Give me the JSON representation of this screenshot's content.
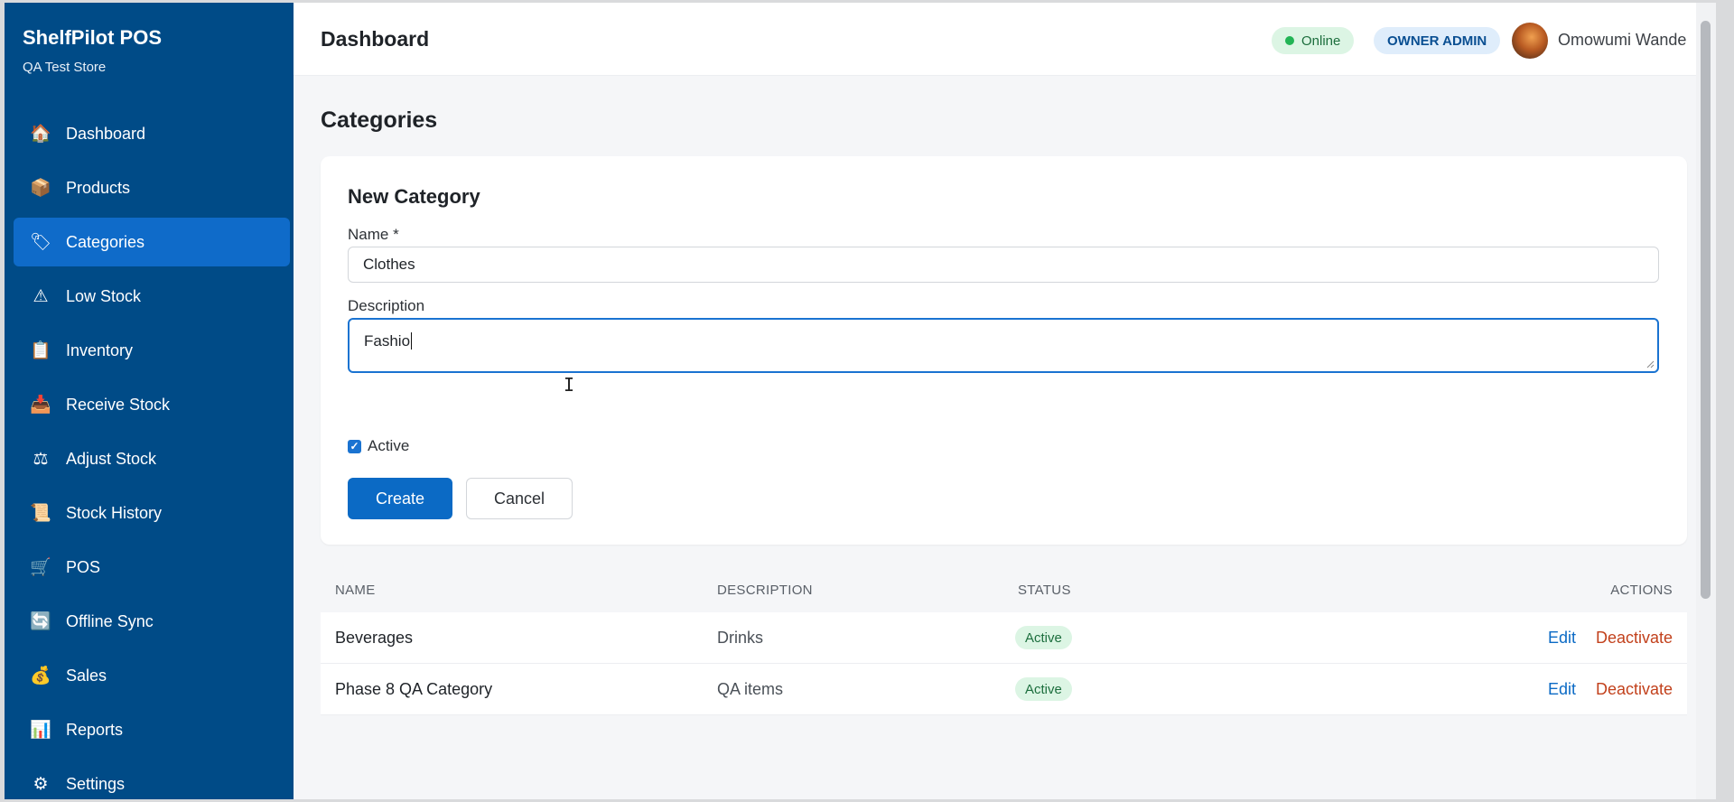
{
  "sidebar": {
    "brand": "ShelfPilot POS",
    "store": "QA Test Store",
    "items": [
      {
        "label": "Dashboard",
        "icon": "house-icon"
      },
      {
        "label": "Products",
        "icon": "box-icon"
      },
      {
        "label": "Categories",
        "icon": "tag-icon",
        "active": true
      },
      {
        "label": "Low Stock",
        "icon": "warning-icon"
      },
      {
        "label": "Inventory",
        "icon": "clipboard-icon"
      },
      {
        "label": "Receive Stock",
        "icon": "inbox-tray-icon"
      },
      {
        "label": "Adjust Stock",
        "icon": "scales-icon"
      },
      {
        "label": "Stock History",
        "icon": "scroll-icon"
      },
      {
        "label": "POS",
        "icon": "cart-icon"
      },
      {
        "label": "Offline Sync",
        "icon": "sync-icon"
      },
      {
        "label": "Sales",
        "icon": "money-bag-icon"
      },
      {
        "label": "Reports",
        "icon": "bar-chart-icon"
      },
      {
        "label": "Settings",
        "icon": "gear-icon"
      }
    ]
  },
  "header": {
    "title": "Dashboard",
    "status": "Online",
    "role": "OWNER ADMIN",
    "user": "Omowumi Wande"
  },
  "page": {
    "title": "Categories"
  },
  "form": {
    "title": "New Category",
    "name_label": "Name *",
    "name_value": "Clothes",
    "description_label": "Description",
    "description_value": "Fashio",
    "active_label": "Active",
    "active_checked": true,
    "create_label": "Create",
    "cancel_label": "Cancel"
  },
  "table": {
    "headers": {
      "name": "NAME",
      "description": "DESCRIPTION",
      "status": "STATUS",
      "actions": "ACTIONS"
    },
    "rows": [
      {
        "name": "Beverages",
        "description": "Drinks",
        "status": "Active",
        "edit": "Edit",
        "deactivate": "Deactivate"
      },
      {
        "name": "Phase 8 QA Category",
        "description": "QA items",
        "status": "Active",
        "edit": "Edit",
        "deactivate": "Deactivate"
      }
    ]
  },
  "colors": {
    "sidebar_bg": "#004b87",
    "active_nav": "#0f6bc9",
    "primary": "#0b6ac5",
    "danger": "#c2411c",
    "success_bg": "#dcf5e4"
  }
}
